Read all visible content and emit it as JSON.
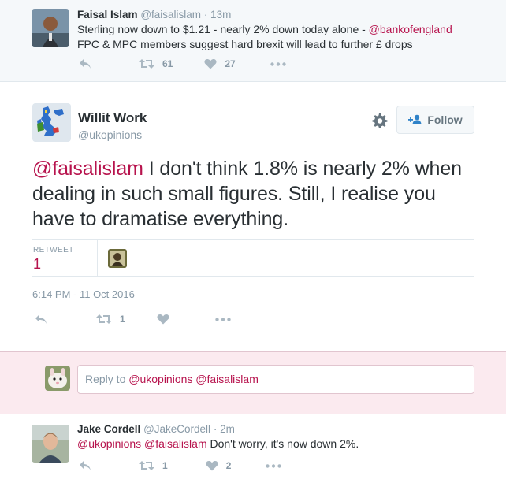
{
  "colors": {
    "link": "#b7134d",
    "muted": "#8899a6",
    "icon": "#aab8c2",
    "reply_bg": "#fbeaef"
  },
  "context_tweet": {
    "name": "Faisal Islam",
    "handle": "@faisalislam",
    "time": "· 13m",
    "text_1": "Sterling now down to $1.21 - nearly 2% down today alone - ",
    "mention": "@bankofengland",
    "text_2": "FPC & MPC members suggest hard brexit will lead to further £ drops",
    "retweets": "61",
    "likes": "27",
    "icons": [
      "reply-icon",
      "retweet-icon",
      "heart-icon",
      "more-icon"
    ]
  },
  "main_tweet": {
    "name": "Willit Work",
    "handle": "@ukopinions",
    "follow_label": "Follow",
    "mention": "@faisalislam",
    "text": " I don't think 1.8% is nearly 2% when dealing in such small figures. Still, I realise you have to dramatise everything.",
    "retweets_label": "RETWEET",
    "retweets_count": "1",
    "timestamp": "6:14 PM - 11 Oct 2016",
    "action_retweets": "1",
    "icons": [
      "gear-icon",
      "follow-user-icon",
      "reply-icon",
      "retweet-icon",
      "heart-icon",
      "more-icon"
    ]
  },
  "reply_box": {
    "prefix": "Reply to ",
    "mentions": "@ukopinions @faisalislam"
  },
  "reply_tweet": {
    "name": "Jake Cordell",
    "handle": "@JakeCordell",
    "time": "· 2m",
    "mentions": "@ukopinions @faisalislam",
    "text": " Don't worry, it's now down 2%.",
    "retweets": "1",
    "likes": "2"
  }
}
